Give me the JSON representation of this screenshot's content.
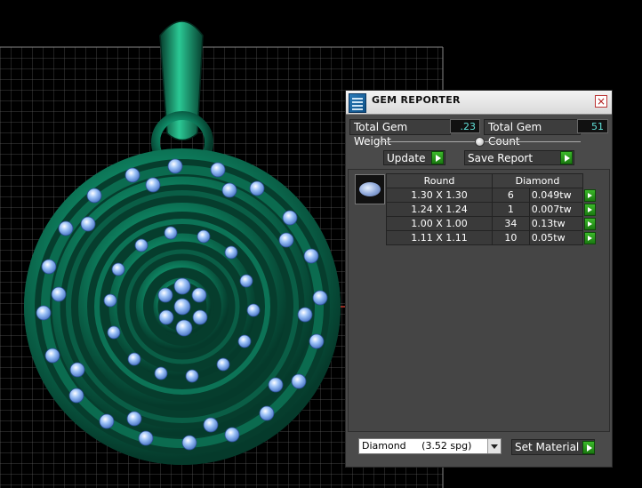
{
  "window": {
    "title": "GEM REPORTER",
    "close_glyph": "×"
  },
  "totals": {
    "weight_label": "Total Gem Weight",
    "weight_value": ".23",
    "count_label": "Total Gem Count",
    "count_value": "51"
  },
  "buttons": {
    "update_label": "Update",
    "save_report_label": "Save Report",
    "set_material_label": "Set Material"
  },
  "table": {
    "shape_header": "Round",
    "material_header": "Diamond",
    "rows": [
      {
        "size": "1.30 X 1.30",
        "count": "6",
        "weight": "0.049tw"
      },
      {
        "size": "1.24 X 1.24",
        "count": "1",
        "weight": "0.007tw"
      },
      {
        "size": "1.00 X 1.00",
        "count": "34",
        "weight": "0.13tw"
      },
      {
        "size": "1.11 X 1.11",
        "count": "10",
        "weight": "0.05tw"
      }
    ]
  },
  "material_select": {
    "value": "Diamond     (3.52 spg)"
  },
  "icons": {
    "app": "gem-reporter-icon",
    "close": "close-icon",
    "play": "play-arrow-icon",
    "gem": "round-gem-icon"
  },
  "colors": {
    "pendant_green": "#0f8a66",
    "gem_blue": "#7fb0f0",
    "value_cyan": "#5fe0d8",
    "button_green": "#2fa520"
  }
}
